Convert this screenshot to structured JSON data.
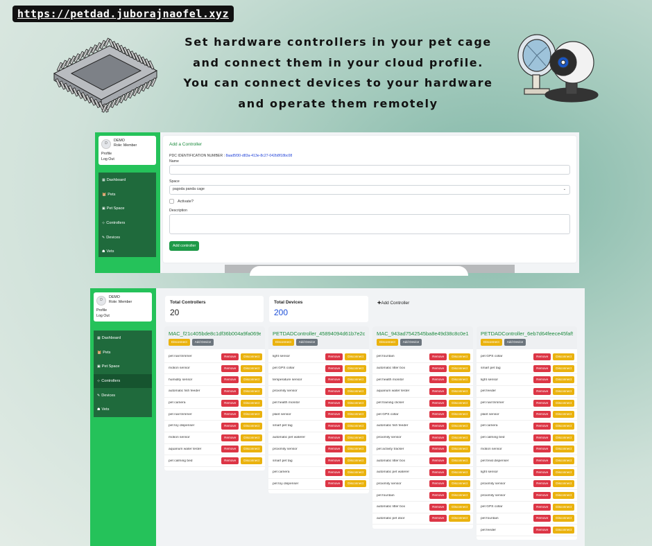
{
  "banner": {
    "url": "https://petdad.juborajnaofel.xyz",
    "headline_lines": [
      "Set hardware controllers in your pet cage",
      "and connect them in your cloud profile.",
      "You can connect devices to your hardware",
      "and operate them remotely"
    ]
  },
  "user": {
    "avatar": "D",
    "name": "DEMO",
    "role": "Role: Member",
    "profile": "Profile",
    "logout": "Log Out"
  },
  "nav": [
    {
      "icon": "dashboard-icon",
      "label": "Dashboard",
      "glyph": "▦"
    },
    {
      "icon": "pets-icon",
      "label": "Pets",
      "glyph": "🐹"
    },
    {
      "icon": "pet-space-icon",
      "label": "Pet Space",
      "glyph": "▣"
    },
    {
      "icon": "controllers-icon",
      "label": "Controllers",
      "glyph": "⊹"
    },
    {
      "icon": "devices-icon",
      "label": "Devices",
      "glyph": "✎"
    },
    {
      "icon": "vets-icon",
      "label": "Vets",
      "glyph": "☗"
    }
  ],
  "form": {
    "title": "Add a Controller",
    "pdc_label": "PDC IDENTIFICATION NUMBER :",
    "pdc_value": "8aad5f30-d83a-413e-8c27-042b8f18bc08",
    "name_label": "Name",
    "name_value": "",
    "space_label": "Space",
    "space_value": "pagoda panda cage",
    "activate_label": "Activate?",
    "description_label": "Description",
    "description_value": "",
    "submit": "Add controller"
  },
  "dashboard": {
    "total_controllers_label": "Total Controllers",
    "total_controllers": "20",
    "total_devices_label": "Total Devices",
    "total_devices": "200",
    "add_controller": "Add Controller",
    "remove": "Remove",
    "disconnect": "Disconnect",
    "add_device": "Add Device",
    "controllers": [
      {
        "name": "MAC_f21c405bde8c1df36b004a9fa069e",
        "devices": [
          "pet nail trimmer",
          "motion sensor",
          "humidity sensor",
          "automatic fish feeder",
          "pet camera",
          "pet nail trimmer",
          "pet toy dispenser",
          "motion sensor",
          "aquarium water tester",
          "pet calming bed"
        ]
      },
      {
        "name": "PETDADController_45894094d61b7e2cf",
        "devices": [
          "light sensor",
          "pet GPS collar",
          "temperature sensor",
          "proximity sensor",
          "pet health monitor",
          "plant sensor",
          "smart pet tag",
          "automatic pet waterer",
          "proximity sensor",
          "smart pet tag",
          "pet camera",
          "pet toy dispenser"
        ]
      },
      {
        "name": "MAC_943ad7542545ba8e49d38c8c0e12",
        "devices": [
          "pet fountain",
          "automatic litter box",
          "pet health monitor",
          "aquarium water tester",
          "pet training clicker",
          "pet GPS collar",
          "automatic fish feeder",
          "proximity sensor",
          "pet activity tracker",
          "automatic litter box",
          "automatic pet waterer",
          "proximity sensor",
          "pet fountain",
          "automatic litter box",
          "automatic pet door"
        ]
      },
      {
        "name": "PETDADController_6eb7d64feece45faf9",
        "devices": [
          "pet GPS collar",
          "smart pet tag",
          "light sensor",
          "pet feeder",
          "pet nail trimmer",
          "plant sensor",
          "pet camera",
          "pet calming bed",
          "motion sensor",
          "pet treat dispenser",
          "light sensor",
          "proximity sensor",
          "proximity sensor",
          "pet GPS collar",
          "pet fountain",
          "pet feeder"
        ]
      }
    ]
  }
}
